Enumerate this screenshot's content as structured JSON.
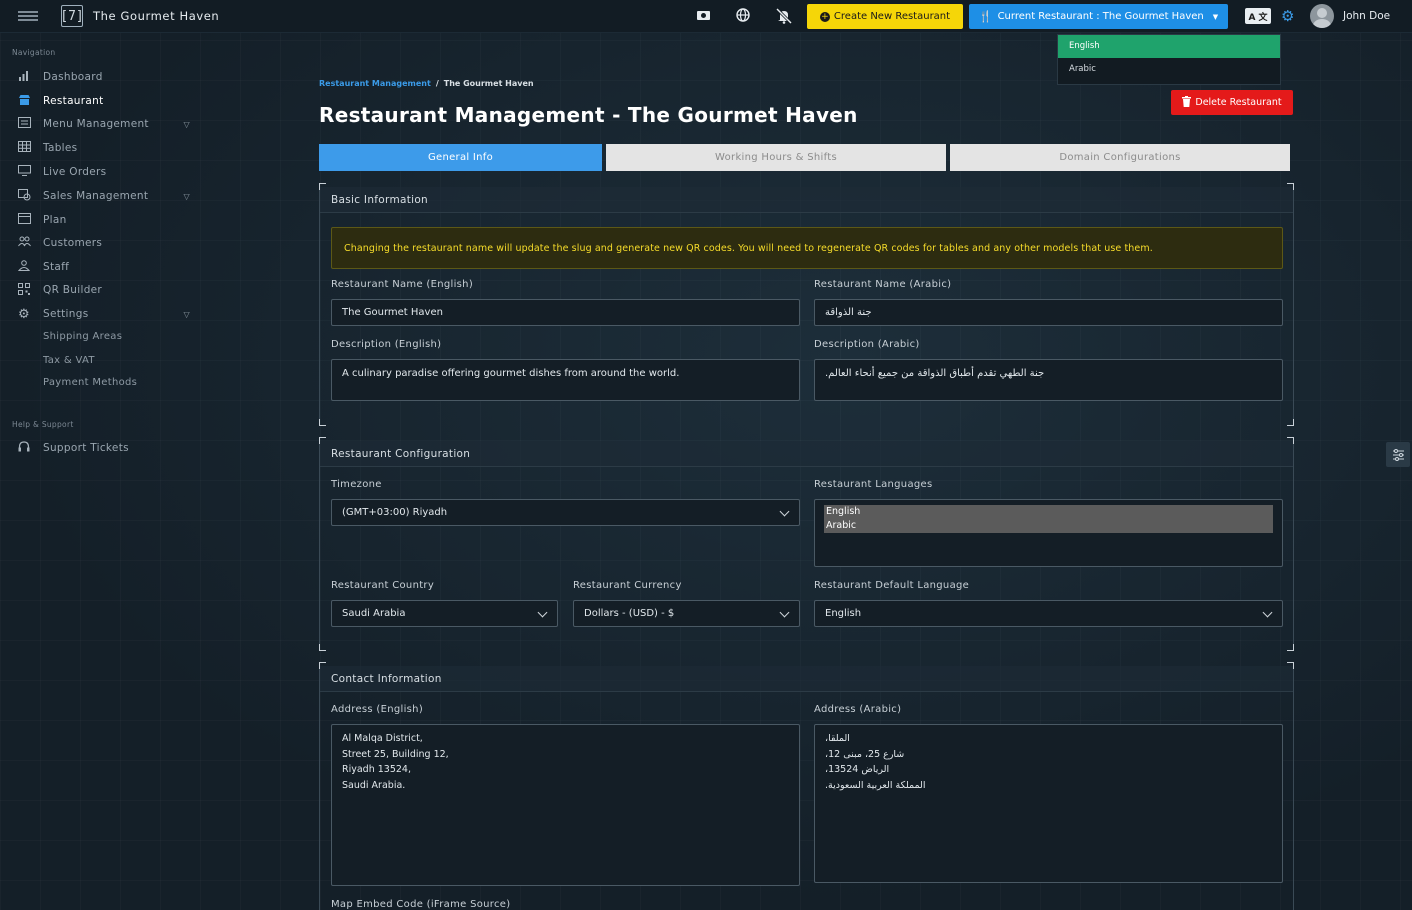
{
  "app": {
    "brand_logo": "[7]",
    "brand_name": "The Gourmet Haven"
  },
  "topbar": {
    "create_label": "Create New Restaurant",
    "current_label": "Current Restaurant : The Gourmet Haven",
    "lang_badge": "A 文",
    "user_name": "John Doe",
    "icons": [
      "camera-icon",
      "globe-icon",
      "bell-off-icon",
      "gear-icon"
    ]
  },
  "lang_menu": {
    "options": [
      "English",
      "Arabic"
    ],
    "selected": "English"
  },
  "sidebar": {
    "nav_heading": "Navigation",
    "items": [
      {
        "label": "Dashboard",
        "icon": "bar-chart-icon"
      },
      {
        "label": "Restaurant",
        "icon": "store-icon"
      },
      {
        "label": "Menu Management",
        "icon": "menu-list-icon"
      },
      {
        "label": "Tables",
        "icon": "table-grid-icon"
      },
      {
        "label": "Live Orders",
        "icon": "monitor-icon"
      },
      {
        "label": "Sales Management",
        "icon": "sales-icon"
      },
      {
        "label": "Plan",
        "icon": "calendar-icon"
      },
      {
        "label": "Customers",
        "icon": "users-icon"
      },
      {
        "label": "Staff",
        "icon": "user-icon"
      },
      {
        "label": "QR Builder",
        "icon": "qr-icon"
      },
      {
        "label": "Settings",
        "icon": "gear-icon"
      }
    ],
    "sub_items": [
      "Shipping Areas",
      "Tax & VAT",
      "Payment Methods"
    ],
    "help_heading": "Help & Support",
    "support_label": "Support Tickets"
  },
  "breadcrumb": {
    "parent": "Restaurant Management",
    "separator": "/",
    "current": "The Gourmet Haven"
  },
  "page_title": "Restaurant Management - The Gourmet Haven",
  "delete_label": "Delete Restaurant",
  "tabs": [
    "General Info",
    "Working Hours & Shifts",
    "Domain Configurations"
  ],
  "basic": {
    "title": "Basic Information",
    "alert": "Changing the restaurant name will update the slug and generate new QR codes. You will need to regenerate QR codes for tables and any other models that use them.",
    "name_en_label": "Restaurant Name (English)",
    "name_en_value": "The Gourmet Haven",
    "name_ar_label": "Restaurant Name (Arabic)",
    "name_ar_value": "جنة الذواقة",
    "desc_en_label": "Description (English)",
    "desc_en_value": "A culinary paradise offering gourmet dishes from around the world.",
    "desc_ar_label": "Description (Arabic)",
    "desc_ar_value": "جنة الطهي تقدم أطباق الذواقة من جميع أنحاء العالم."
  },
  "config": {
    "title": "Restaurant Configuration",
    "timezone_label": "Timezone",
    "timezone_value": "(GMT+03:00) Riyadh",
    "languages_label": "Restaurant Languages",
    "languages": [
      "English",
      "Arabic"
    ],
    "country_label": "Restaurant Country",
    "country_value": "Saudi Arabia",
    "currency_label": "Restaurant Currency",
    "currency_value": "Dollars - (USD) - $",
    "default_lang_label": "Restaurant Default Language",
    "default_lang_value": "English"
  },
  "contact": {
    "title": "Contact Information",
    "addr_en_label": "Address (English)",
    "addr_en_lines": [
      "Al Malqa District,",
      "Street 25, Building 12,",
      "Riyadh 13524,",
      "Saudi Arabia."
    ],
    "addr_ar_label": "Address (Arabic)",
    "addr_ar_lines": [
      "الملقا،",
      "شارع 25، مبنى 12،",
      "الرياض 13524،",
      "المملكة العربية السعودية."
    ],
    "map_label": "Map Embed Code (iFrame Source)"
  }
}
